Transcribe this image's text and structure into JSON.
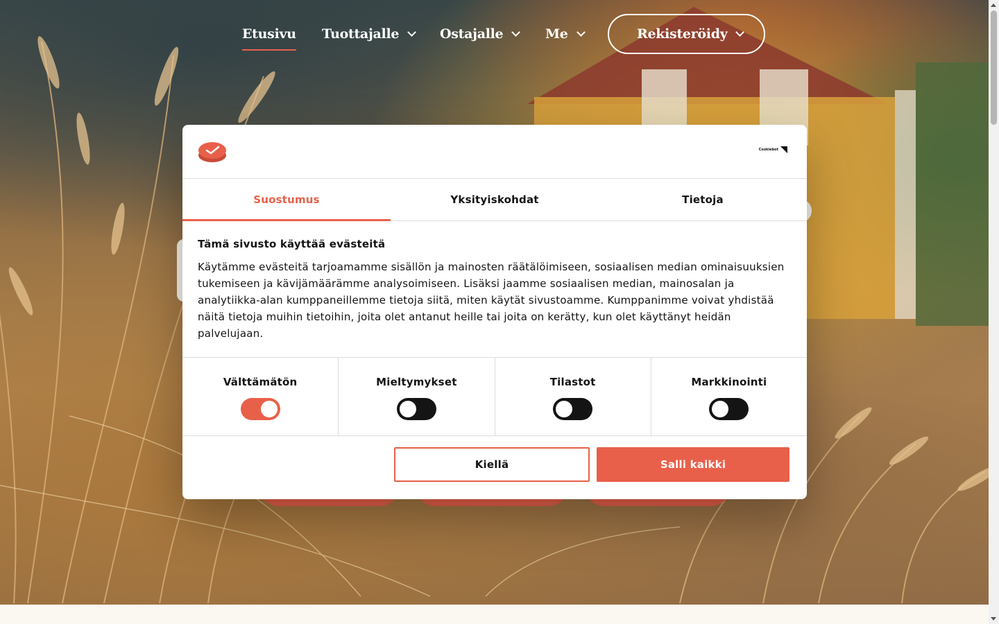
{
  "nav": {
    "items": [
      {
        "label": "Etusivu"
      },
      {
        "label": "Tuottajalle"
      },
      {
        "label": "Ostajalle"
      },
      {
        "label": "Me"
      }
    ],
    "register_label": "Rekisteröidy"
  },
  "cookie_dialog": {
    "brand_badge": "Cookiebot",
    "tabs": [
      {
        "label": "Suostumus"
      },
      {
        "label": "Yksityiskohdat"
      },
      {
        "label": "Tietoja"
      }
    ],
    "heading": "Tämä sivusto käyttää evästeitä",
    "body": "Käytämme evästeitä tarjoamamme sisällön ja mainosten räätälöimiseen, sosiaalisen median ominaisuuksien tukemiseen ja kävijämäärämme analysoimiseen. Lisäksi jaamme sosiaalisen median, mainosalan ja analytiikka-alan kumppaneillemme tietoja siitä, miten käytät sivustoamme. Kumppanimme voivat yhdistää näitä tietoja muihin tietoihin, joita olet antanut heille tai joita on kerätty, kun olet käyttänyt heidän palvelujaan.",
    "categories": [
      {
        "label": "Välttämätön",
        "enabled": true
      },
      {
        "label": "Mieltymykset",
        "enabled": false
      },
      {
        "label": "Tilastot",
        "enabled": false
      },
      {
        "label": "Markkinointi",
        "enabled": false
      }
    ],
    "deny_label": "Kiellä",
    "allow_all_label": "Salli kaikki"
  },
  "colors": {
    "accent": "#e8604a",
    "toggle_off": "#141414",
    "text": "#141414"
  }
}
